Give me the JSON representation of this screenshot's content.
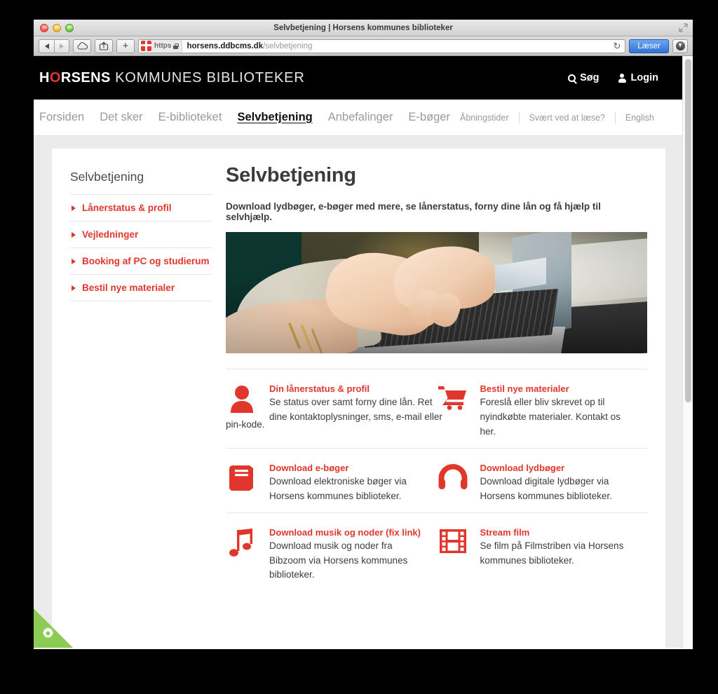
{
  "browser": {
    "window_title": "Selvbetjening | Horsens kommunes biblioteker",
    "https_label": "https",
    "url_host": "horsens.ddbcms.dk",
    "url_path": "/selvbetjening",
    "reader_button": "Læser",
    "reload_glyph": "↻",
    "plus_glyph": "+"
  },
  "site": {
    "logo": {
      "part1": "H",
      "o": "O",
      "part2": "RSENS",
      "part3": " KOMMUNES BIBLIOTEKER"
    },
    "header_actions": [
      {
        "label": "Søg",
        "icon": "search-icon"
      },
      {
        "label": "Login",
        "icon": "user-icon"
      }
    ],
    "nav": [
      {
        "label": "Forsiden",
        "active": false
      },
      {
        "label": "Det sker",
        "active": false
      },
      {
        "label": "E-biblioteket",
        "active": false
      },
      {
        "label": "Selvbetjening",
        "active": true
      },
      {
        "label": "Anbefalinger",
        "active": false
      },
      {
        "label": "E-bøger",
        "active": false
      }
    ],
    "nav_utility": [
      {
        "label": "Åbningstider"
      },
      {
        "label": "Svært ved at læse?"
      },
      {
        "label": "English"
      }
    ]
  },
  "sidebar": {
    "title": "Selvbetjening",
    "items": [
      {
        "label": "Lånerstatus & profil"
      },
      {
        "label": "Vejledninger"
      },
      {
        "label": "Booking af PC og studierum"
      },
      {
        "label": "Bestil nye materialer"
      }
    ]
  },
  "main": {
    "title": "Selvbetjening",
    "intro": "Download lydbøger, e-bøger med mere, se lånerstatus, forny dine lån og få hjælp til selvhjælp.",
    "banner_alt": "Hænder der skriver på en bærbar computer",
    "services": [
      {
        "icon": "user-icon",
        "title": "Din lånerstatus & profil",
        "desc": "Se status over samt forny dine lån. Ret dine kontaktoplysninger, sms, e-mail eller",
        "desc_overflow": "pin-kode."
      },
      {
        "icon": "shopping-cart-icon",
        "title": "Bestil nye materialer",
        "desc": "Foreslå eller bliv skrevet op til nyindkøbte materialer. Kontakt os her."
      },
      {
        "icon": "book-icon",
        "title": "Download e-bøger",
        "desc": "Download elektroniske bøger via Horsens kommunes biblioteker."
      },
      {
        "icon": "headphones-icon",
        "title": "Download lydbøger",
        "desc": "Download digitale lydbøger via Horsens kommunes biblioteker."
      },
      {
        "icon": "music-note-icon",
        "title": "Download musik og noder (fix link)",
        "desc": "Download musik og noder fra Bibzoom via Horsens kommunes biblioteker."
      },
      {
        "icon": "film-strip-icon",
        "title": "Stream film",
        "desc": "Se film på Filmstriben via Horsens kommunes biblioteker."
      }
    ]
  },
  "corner_badge": {
    "icon": "gear-icon",
    "color": "#8ccc55"
  },
  "colors": {
    "brand_red": "#e0362c",
    "text_dark": "#3c3c3c",
    "nav_muted": "#9a9a9a",
    "page_bg": "#ebebeb",
    "accent_blue": "#2f72d8"
  }
}
